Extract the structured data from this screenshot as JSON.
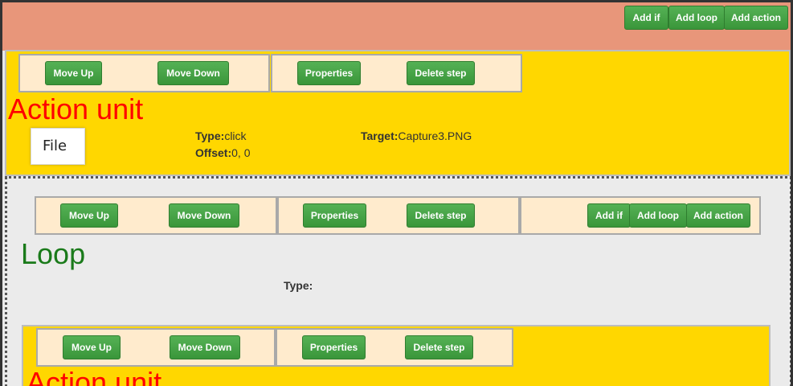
{
  "top_bar": {
    "add_if": "Add if",
    "add_loop": "Add loop",
    "add_action": "Add action"
  },
  "action_unit_1": {
    "toolbar": {
      "move_up": "Move Up",
      "move_down": "Move Down",
      "properties": "Properties",
      "delete_step": "Delete step"
    },
    "title": "Action unit",
    "thumbnail_text": "File",
    "type_label": "Type:",
    "type_value": "click",
    "offset_label": "Offset:",
    "offset_value": "0, 0",
    "target_label": "Target:",
    "target_value": "Capture3.PNG"
  },
  "loop_unit": {
    "toolbar": {
      "move_up": "Move Up",
      "move_down": "Move Down",
      "properties": "Properties",
      "delete_step": "Delete step",
      "add_if": "Add if",
      "add_loop": "Add loop",
      "add_action": "Add action"
    },
    "title": "Loop",
    "type_label": "Type:",
    "type_value": ""
  },
  "action_unit_2": {
    "toolbar": {
      "move_up": "Move Up",
      "move_down": "Move Down",
      "properties": "Properties",
      "delete_step": "Delete step"
    },
    "title": "Action unit"
  },
  "colors": {
    "top_bar": "#e8967a",
    "action_unit_bg": "#ffd700",
    "toolbar_cell_bg": "#ffebcd",
    "button_green": "#449d44",
    "action_title": "#ff0000",
    "loop_title": "#1a7a1a"
  },
  "icons": {
    "thumbnail": "image-thumbnail-icon"
  }
}
